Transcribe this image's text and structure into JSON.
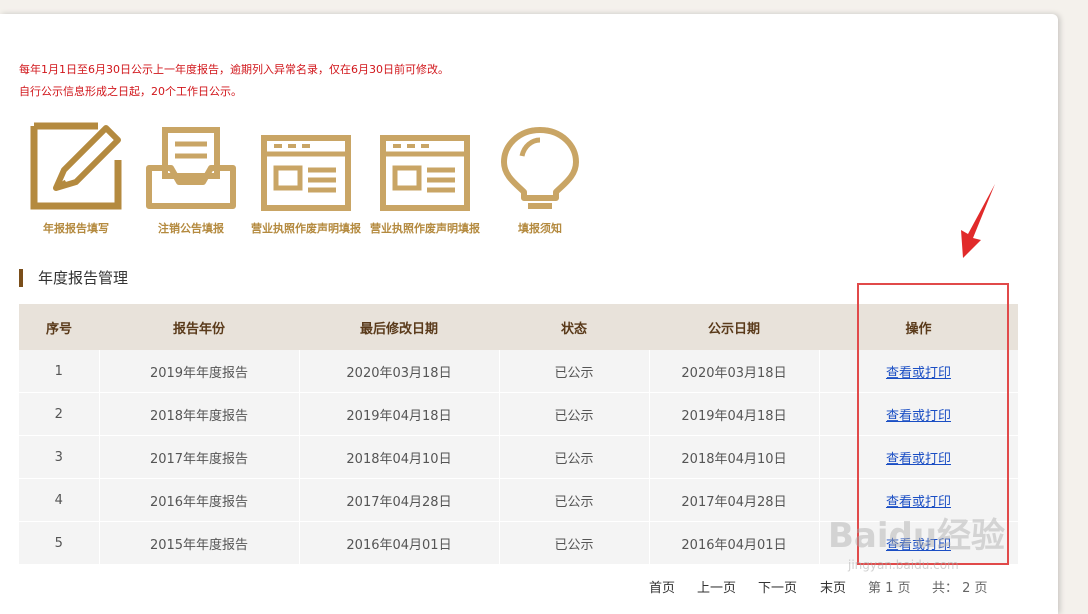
{
  "notice": {
    "line1": "每年1月1日至6月30日公示上一年度报告，逾期列入异常名录，仅在6月30日前可修改。",
    "line2": "自行公示信息形成之日起，20个工作日公示。"
  },
  "tiles": [
    {
      "label": "年报报告填写",
      "icon": "edit-report-icon"
    },
    {
      "label": "注销公告填报",
      "icon": "inbox-tray-icon"
    },
    {
      "label": "营业执照作废声明填报",
      "icon": "license-card-icon"
    },
    {
      "label": "营业执照作废声明填报",
      "icon": "license-card-icon"
    },
    {
      "label": "填报须知",
      "icon": "lightbulb-icon"
    }
  ],
  "section_title": "年度报告管理",
  "table": {
    "headers": [
      "序号",
      "报告年份",
      "最后修改日期",
      "状态",
      "公示日期",
      "操作"
    ],
    "rows": [
      {
        "no": "1",
        "year": "2019年年度报告",
        "modified": "2020年03月18日",
        "status": "已公示",
        "published": "2020年03月18日",
        "action": "查看或打印"
      },
      {
        "no": "2",
        "year": "2018年年度报告",
        "modified": "2019年04月18日",
        "status": "已公示",
        "published": "2019年04月18日",
        "action": "查看或打印"
      },
      {
        "no": "3",
        "year": "2017年年度报告",
        "modified": "2018年04月10日",
        "status": "已公示",
        "published": "2018年04月10日",
        "action": "查看或打印"
      },
      {
        "no": "4",
        "year": "2016年年度报告",
        "modified": "2017年04月28日",
        "status": "已公示",
        "published": "2017年04月28日",
        "action": "查看或打印"
      },
      {
        "no": "5",
        "year": "2015年年度报告",
        "modified": "2016年04月01日",
        "status": "已公示",
        "published": "2016年04月01日",
        "action": "查看或打印"
      }
    ]
  },
  "pager": {
    "first": "首页",
    "prev": "上一页",
    "next": "下一页",
    "last": "末页",
    "current": "第 1 页",
    "total": "共： 2 页"
  },
  "watermark": {
    "brand": "Baidu经验",
    "url": "jingyan.baidu.com"
  },
  "colors": {
    "accent": "#b48a3f",
    "notice": "#d1161b",
    "link": "#1a4ec4",
    "highlight": "#e14a4a"
  }
}
